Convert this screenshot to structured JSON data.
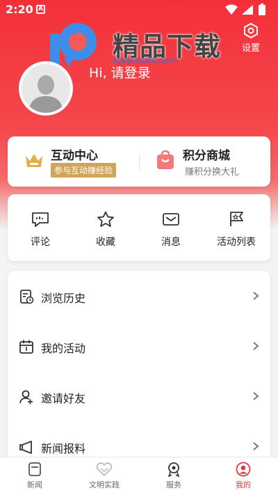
{
  "status_bar": {
    "time": "2:20",
    "notification_glyph": "A"
  },
  "watermark": {
    "brand": "精品下载",
    "url": "www.kxdw.com"
  },
  "header": {
    "settings_label": "设置",
    "greeting": "Hi, 请登录"
  },
  "cards": {
    "interaction": {
      "title": "互动中心",
      "badge": "参与互动赚经验"
    },
    "points": {
      "title": "积分商城",
      "subtitle": "赚积分换大礼"
    }
  },
  "quick_actions": [
    {
      "label": "评论",
      "icon": "comment-icon"
    },
    {
      "label": "收藏",
      "icon": "star-icon"
    },
    {
      "label": "消息",
      "icon": "envelope-icon"
    },
    {
      "label": "活动列表",
      "icon": "flag-icon"
    }
  ],
  "menu": [
    {
      "label": "浏览历史",
      "icon": "history-icon"
    },
    {
      "label": "我的活动",
      "icon": "calendar-icon"
    },
    {
      "label": "邀请好友",
      "icon": "invite-user-icon"
    },
    {
      "label": "新闻报料",
      "icon": "news-tip-icon"
    }
  ],
  "tabs": [
    {
      "label": "新闻",
      "icon": "news-icon",
      "active": false
    },
    {
      "label": "文明实践",
      "icon": "heart-icon",
      "active": false
    },
    {
      "label": "服务",
      "icon": "service-icon",
      "active": false
    },
    {
      "label": "我的",
      "icon": "profile-icon",
      "active": true
    }
  ],
  "colors": {
    "primary": "#f3303a",
    "accent_gold": "#cfa55a",
    "active_tab": "#e8333c"
  }
}
